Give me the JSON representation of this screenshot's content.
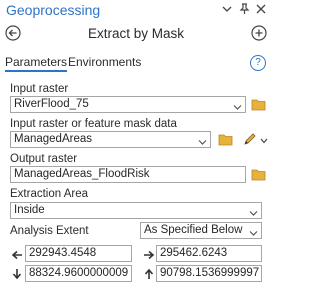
{
  "window": {
    "title": "Geoprocessing"
  },
  "tool": {
    "title": "Extract by Mask"
  },
  "tabs": [
    {
      "label": "Parameters"
    },
    {
      "label": "Environments"
    }
  ],
  "help": {
    "glyph": "?"
  },
  "form": {
    "input_raster": {
      "label": "Input raster",
      "value": "RiverFlood_75"
    },
    "mask_data": {
      "label": "Input raster or feature mask data",
      "value": "ManagedAreas"
    },
    "output_raster": {
      "label": "Output raster",
      "value": "ManagedAreas_FloodRisk"
    },
    "extraction_area": {
      "label": "Extraction Area",
      "value": "Inside"
    },
    "analysis_extent": {
      "label": "Analysis Extent",
      "value": "As Specified Below",
      "left": "292943.4548",
      "right": "295462.6243",
      "bottom": "88324.9600000009",
      "top": "90798.1536999997"
    }
  },
  "icons": {
    "pin": "pin-icon",
    "menu": "menu-icon",
    "close": "close-icon",
    "back": "back-arrow-icon",
    "add": "add-circle-icon",
    "folder": "folder-icon",
    "pencil": "pencil-icon",
    "chevron": "chevron-down-icon",
    "extent_left": "arrow-left-icon",
    "extent_right": "arrow-right-icon",
    "extent_bottom": "arrow-down-icon",
    "extent_top": "arrow-up-icon"
  },
  "colors": {
    "accent": "#2d73c8",
    "folder": "#e8b23a",
    "border": "#a6a6a6"
  }
}
